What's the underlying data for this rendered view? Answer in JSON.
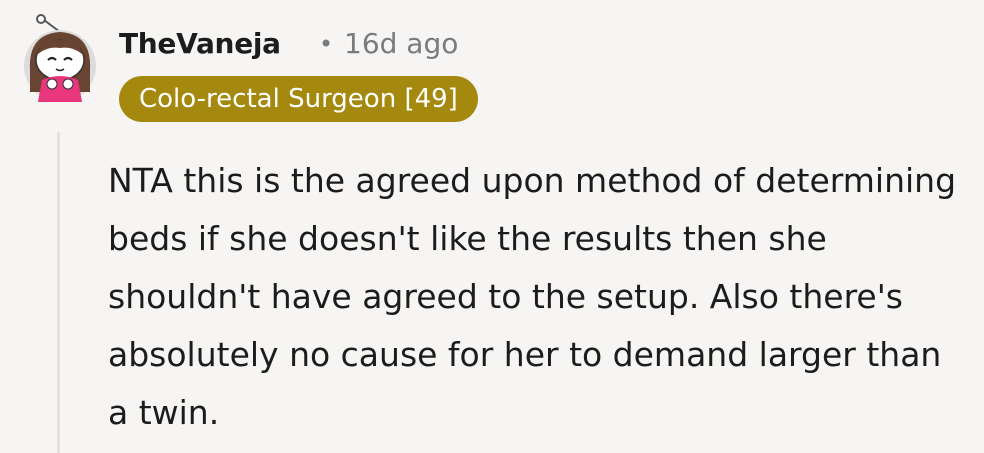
{
  "comment": {
    "author": "TheVaneja",
    "separator": "•",
    "timestamp": "16d ago",
    "flair": "Colo-rectal Surgeon [49]",
    "body": "NTA this is the agreed upon method of determining beds if she doesn't like the results then she shouldn't have agreed to the setup. Also there's absolutely no cause for her to demand larger than a twin.",
    "avatar_icon": "snoo-avatar-icon"
  },
  "colors": {
    "flair_bg": "#a4890e",
    "flair_text": "#ffffff",
    "author": "#1c1c1c",
    "meta": "#787c7e",
    "thread_line": "#e4e2de",
    "background": "#f6f5f3"
  }
}
